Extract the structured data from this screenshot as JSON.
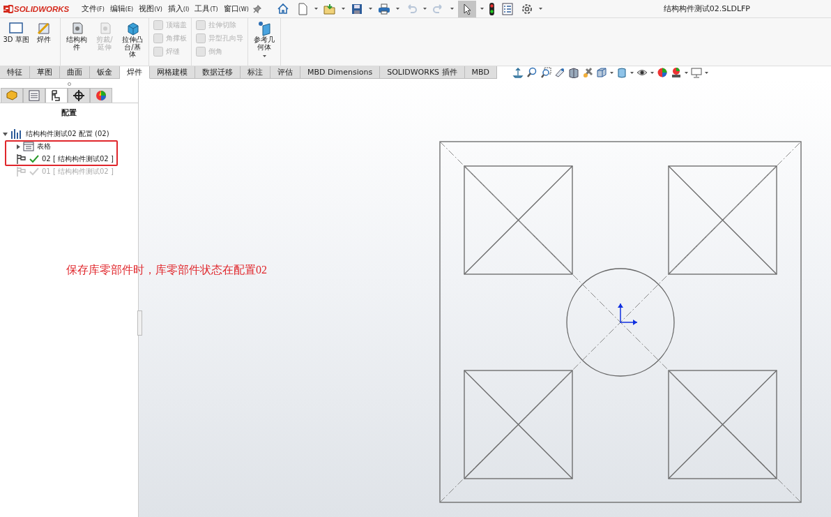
{
  "app": {
    "logo": "SOLIDWORKS",
    "title": "结构构件测试02.SLDLFP"
  },
  "menu": [
    {
      "label": "文件",
      "key": "(F)"
    },
    {
      "label": "编辑",
      "key": "(E)"
    },
    {
      "label": "视图",
      "key": "(V)"
    },
    {
      "label": "插入",
      "key": "(I)"
    },
    {
      "label": "工具",
      "key": "(T)"
    },
    {
      "label": "窗口",
      "key": "(W)"
    }
  ],
  "quick_tools": [
    {
      "kind": "home",
      "selected": false
    },
    {
      "kind": "new",
      "selected": false
    },
    {
      "kind": "open",
      "selected": false
    },
    {
      "kind": "save",
      "selected": false
    },
    {
      "kind": "print",
      "selected": false
    },
    {
      "kind": "undo",
      "selected": false
    },
    {
      "kind": "redo",
      "selected": false
    },
    {
      "kind": "select",
      "selected": true
    },
    {
      "kind": "rebuild",
      "selected": false
    },
    {
      "kind": "options-list",
      "selected": false
    },
    {
      "kind": "settings",
      "selected": false
    }
  ],
  "ribbon": [
    {
      "items": [
        {
          "label": "3D 草图",
          "kind": "large",
          "disabled": false
        },
        {
          "label": "焊件",
          "kind": "large",
          "disabled": false
        }
      ]
    },
    {
      "items": [
        {
          "label": "结构构件",
          "kind": "large",
          "disabled": false
        },
        {
          "label": "剪裁/延伸",
          "kind": "large",
          "disabled": true
        },
        {
          "label": "拉伸凸台/基体",
          "kind": "large",
          "disabled": false
        }
      ]
    },
    {
      "items": [
        {
          "label": "顶端盖",
          "kind": "small",
          "disabled": true
        },
        {
          "label": "角撑板",
          "kind": "small",
          "disabled": true
        },
        {
          "label": "焊缝",
          "kind": "small",
          "disabled": true
        }
      ]
    },
    {
      "items": [
        {
          "label": "拉伸切除",
          "kind": "small",
          "disabled": true
        },
        {
          "label": "异型孔向导",
          "kind": "small",
          "disabled": true
        },
        {
          "label": "倒角",
          "kind": "small",
          "disabled": true
        }
      ]
    },
    {
      "items": [
        {
          "label": "参考几何体",
          "kind": "dropdown",
          "disabled": false
        }
      ]
    }
  ],
  "tabs": [
    {
      "label": "特征",
      "selected": false
    },
    {
      "label": "草图",
      "selected": false
    },
    {
      "label": "曲面",
      "selected": false
    },
    {
      "label": "钣金",
      "selected": false
    },
    {
      "label": "焊件",
      "selected": true
    },
    {
      "label": "网格建模",
      "selected": false
    },
    {
      "label": "数据迁移",
      "selected": false
    },
    {
      "label": "标注",
      "selected": false
    },
    {
      "label": "评估",
      "selected": false
    },
    {
      "label": "MBD Dimensions",
      "selected": false
    },
    {
      "label": "SOLIDWORKS 插件",
      "selected": false
    },
    {
      "label": "MBD",
      "selected": false
    }
  ],
  "panel": {
    "tabs": [
      {
        "kind": "feature-tree",
        "selected": false
      },
      {
        "kind": "property",
        "selected": false
      },
      {
        "kind": "configuration",
        "selected": true
      },
      {
        "kind": "dimxpert",
        "selected": false
      },
      {
        "kind": "display",
        "selected": false
      }
    ],
    "heading": "配置",
    "tree": {
      "label": "结构构件测试02 配置  (02)",
      "expanded": true,
      "children": [
        {
          "label": "表格",
          "kind": "table"
        },
        {
          "label": "02 [ 结构构件测试02 ]",
          "kind": "config",
          "active": true
        },
        {
          "label": "01 [ 结构构件测试02 ]",
          "kind": "config",
          "active": false
        }
      ]
    }
  },
  "annotation": {
    "text": "保存库零部件时，库零部件状态在配置02"
  }
}
